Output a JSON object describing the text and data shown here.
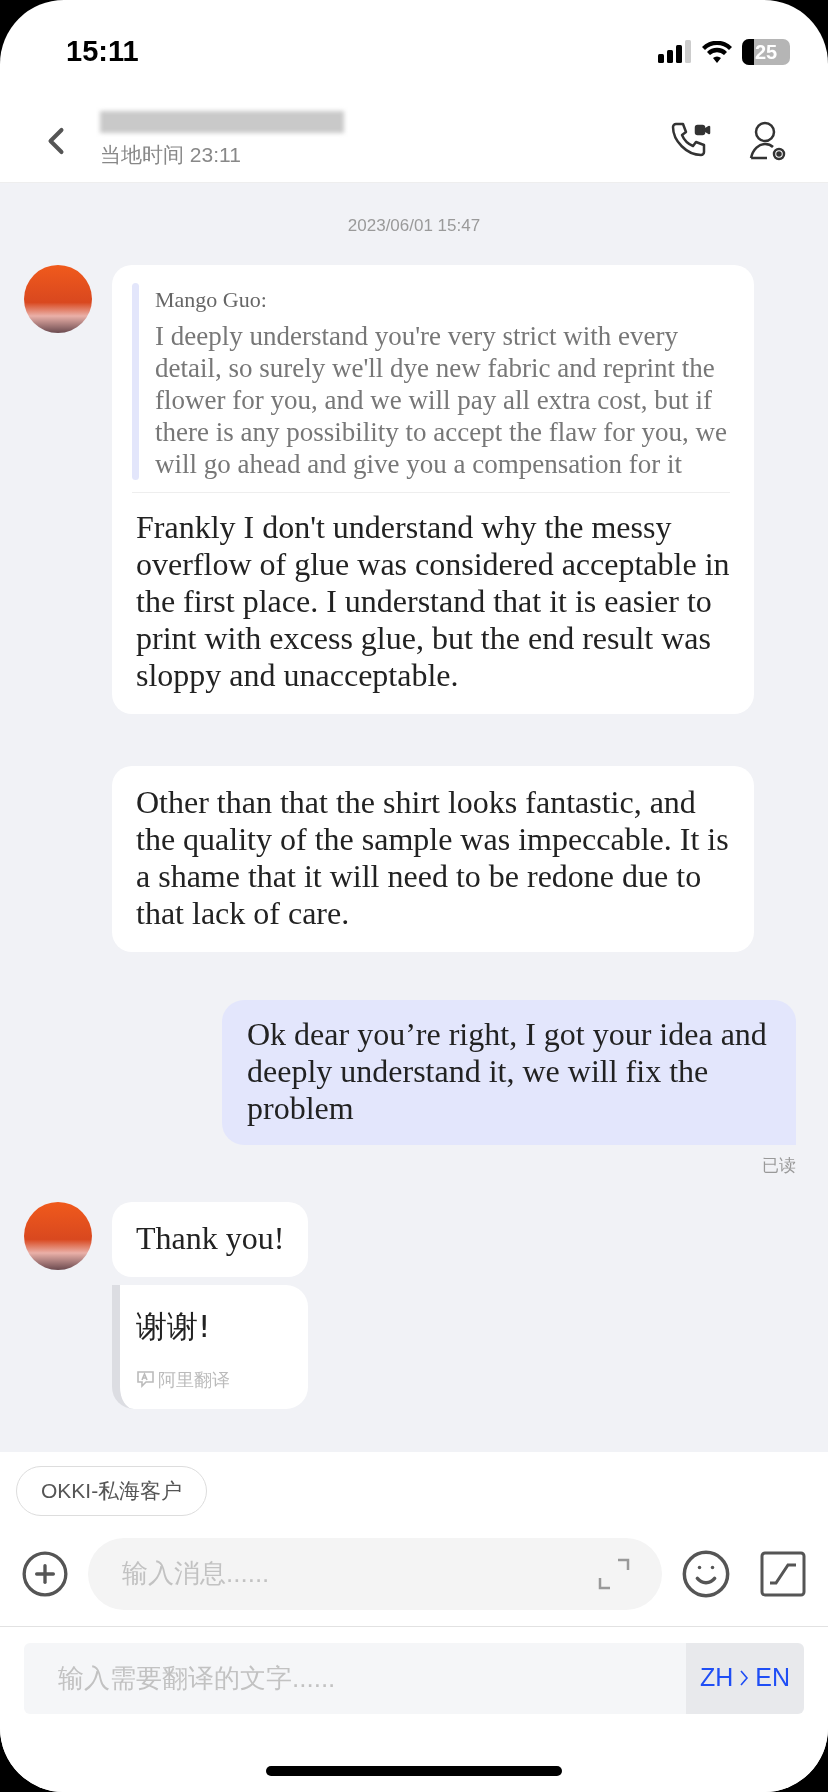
{
  "status_bar": {
    "time": "15:11",
    "battery": "25"
  },
  "header": {
    "subtitle": "当地时间 23:11"
  },
  "messages": [
    {
      "kind": "timestamp",
      "text": "2023/06/01 15:47"
    },
    {
      "kind": "incoming",
      "avatar": true,
      "quote": {
        "author": "Mango Guo:",
        "text": "I deeply understand you're very strict with every detail, so surely we'll dye new fabric and reprint the flower for you, and we will pay all extra cost, but if there is any possibility to accept the flaw for you, we will go ahead and give you a compensation for it"
      },
      "text": "Frankly I don't understand why the messy overflow of glue was considered acceptable in the first place. I understand that it is easier to print with excess glue, but the end result was sloppy and unacceptable."
    },
    {
      "kind": "incoming",
      "avatar": false,
      "text": "Other than that the shirt looks fantastic, and the quality of the sample was impeccable. It is a shame that it will need to be redone due to that lack of care."
    },
    {
      "kind": "outgoing",
      "text": "Ok dear you’re right, I got your idea and deeply understand it, we will fix the problem",
      "receipt": "已读"
    },
    {
      "kind": "incoming",
      "avatar": true,
      "text": "Thank you!",
      "translation": {
        "text": "谢谢!",
        "source": "阿里翻译"
      }
    }
  ],
  "tag": "OKKI-私海客户",
  "composer": {
    "placeholder": "输入消息......"
  },
  "translator": {
    "placeholder": "输入需要翻译的文字......",
    "from": "ZH",
    "to": "EN"
  }
}
